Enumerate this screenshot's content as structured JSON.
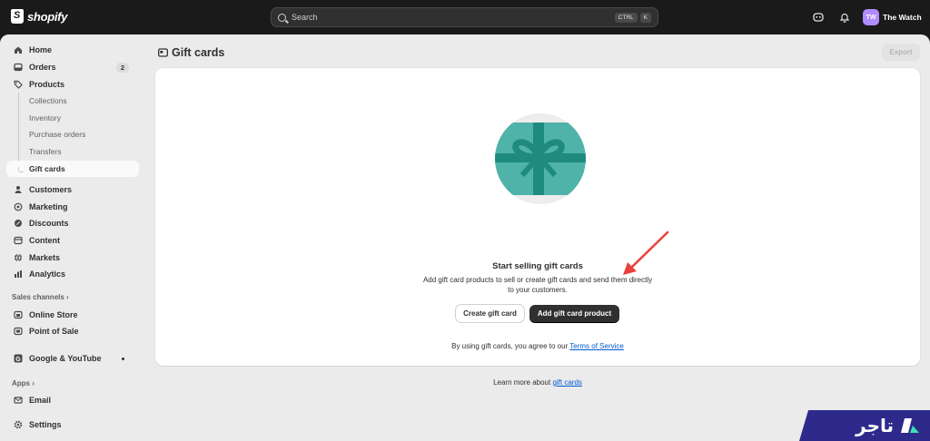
{
  "app": {
    "logo_text": "shopify",
    "store_initials": "TW",
    "store_name": "The Watch"
  },
  "search": {
    "placeholder": "Search",
    "shortcut_1": "CTRL",
    "shortcut_2": "K"
  },
  "sidebar": {
    "home": "Home",
    "orders": "Orders",
    "orders_count": "2",
    "products": "Products",
    "collections": "Collections",
    "inventory": "Inventory",
    "purchase_orders": "Purchase orders",
    "transfers": "Transfers",
    "gift_cards": "Gift cards",
    "customers": "Customers",
    "marketing": "Marketing",
    "discounts": "Discounts",
    "content": "Content",
    "markets": "Markets",
    "analytics": "Analytics",
    "sales_channels": "Sales channels",
    "online_store": "Online Store",
    "point_of_sale": "Point of Sale",
    "google_youtube": "Google & YouTube",
    "apps": "Apps",
    "email": "Email",
    "settings": "Settings"
  },
  "page": {
    "title": "Gift cards",
    "export_label": "Export",
    "empty_title": "Start selling gift cards",
    "empty_desc": "Add gift card products to sell or create gift cards and send them directly to your customers.",
    "create_label": "Create gift card",
    "add_product_label": "Add gift card product",
    "terms_prefix": "By using gift cards, you agree to our",
    "terms_link": "Terms of Service",
    "learn_prefix": "Learn more about",
    "learn_link": "gift cards"
  },
  "watermark": {
    "text": "تاجر"
  },
  "colors": {
    "accent_teal": "#4fb3a9",
    "teal_dark": "#1f8a80",
    "primary": "#303030",
    "link": "#005bd3",
    "annotation_arrow": "#e8403a",
    "watermark_bg": "#2d2a8c"
  }
}
